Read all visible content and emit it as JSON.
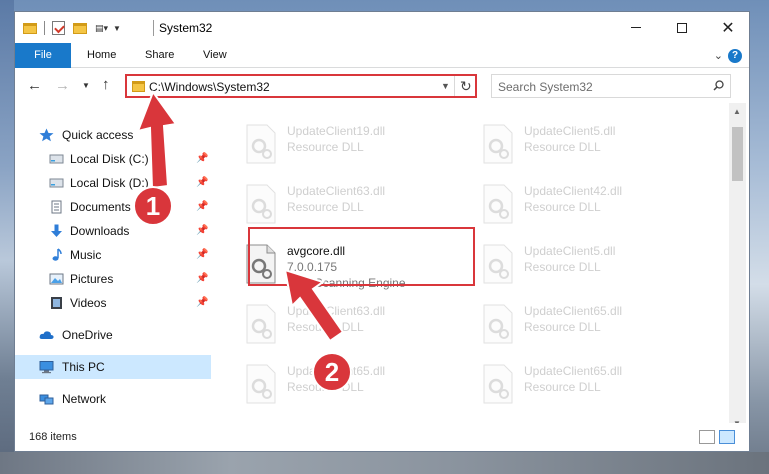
{
  "window": {
    "title": "System32"
  },
  "ribbon": {
    "tabs": [
      "File",
      "Home",
      "Share",
      "View"
    ]
  },
  "address": {
    "path": "C:\\Windows\\System32"
  },
  "search": {
    "placeholder": "Search System32"
  },
  "nav": {
    "items": [
      {
        "label": "Quick access",
        "icon": "star-icon"
      },
      {
        "label": "Local Disk (C:)",
        "icon": "drive-icon"
      },
      {
        "label": "Local Disk (D:)",
        "icon": "drive-icon"
      },
      {
        "label": "Documents",
        "icon": "document-icon"
      },
      {
        "label": "Downloads",
        "icon": "download-icon"
      },
      {
        "label": "Music",
        "icon": "music-icon"
      },
      {
        "label": "Pictures",
        "icon": "picture-icon"
      },
      {
        "label": "Videos",
        "icon": "video-icon"
      },
      {
        "label": "OneDrive",
        "icon": "cloud-icon"
      },
      {
        "label": "This PC",
        "icon": "computer-icon"
      },
      {
        "label": "Network",
        "icon": "network-icon"
      }
    ]
  },
  "files": [
    {
      "name": "UpdateClient19.dll",
      "desc": "Resource DLL"
    },
    {
      "name": "UpdateClient5.dll",
      "desc": "Resource DLL"
    },
    {
      "name": "UpdateClient63.dll",
      "desc": "Resource DLL"
    },
    {
      "name": "UpdateClient42.dll",
      "desc": "Resource DLL"
    },
    {
      "name": "avgcore.dll",
      "version": "7.0.0.175",
      "desc": "AVG Scanning Engine"
    },
    {
      "name": "UpdateClient5.dll",
      "desc": "Resource DLL"
    },
    {
      "name": "UpdateClient63.dll",
      "desc": "Resource DLL"
    },
    {
      "name": "UpdateClient65.dll",
      "desc": "Resource DLL"
    },
    {
      "name": "UpdateClient65.dll",
      "desc": "Resource DLL"
    },
    {
      "name": "UpdateClient65.dll",
      "desc": "Resource DLL"
    }
  ],
  "status": {
    "count": "168 items"
  },
  "annotations": {
    "step1": "1",
    "step2": "2",
    "color": "#d9363b"
  }
}
